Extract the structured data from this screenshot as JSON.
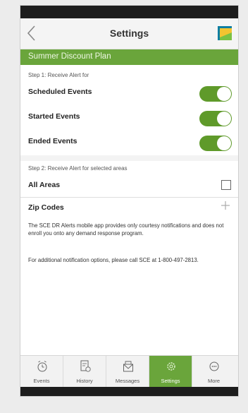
{
  "header": {
    "title": "Settings"
  },
  "plan": {
    "name": "Summer Discount Plan"
  },
  "step1": {
    "label": "Step 1: Receive Alert for",
    "items": [
      {
        "label": "Scheduled Events",
        "enabled": true
      },
      {
        "label": "Started Events",
        "enabled": true
      },
      {
        "label": "Ended Events",
        "enabled": true
      }
    ]
  },
  "step2": {
    "label": "Step 2: Receive Alert for selected areas",
    "all_areas": {
      "label": "All Areas",
      "checked": false
    },
    "zip_codes": {
      "label": "Zip Codes"
    }
  },
  "info": {
    "disclaimer": "The SCE DR Alerts mobile app provides only courtesy notifications and does not enroll you onto any demand response program.",
    "contact": "For additional notification options, please call SCE at 1-800-497-2813."
  },
  "tabs": [
    {
      "label": "Events",
      "icon": "alarm-clock-icon",
      "active": false
    },
    {
      "label": "History",
      "icon": "history-icon",
      "active": false
    },
    {
      "label": "Messages",
      "icon": "envelope-icon",
      "active": false
    },
    {
      "label": "Settings",
      "icon": "gear-icon",
      "active": true
    },
    {
      "label": "More",
      "icon": "more-icon",
      "active": false
    }
  ],
  "colors": {
    "brand_green": "#6aa53b",
    "toggle_green": "#5f9a2a"
  }
}
